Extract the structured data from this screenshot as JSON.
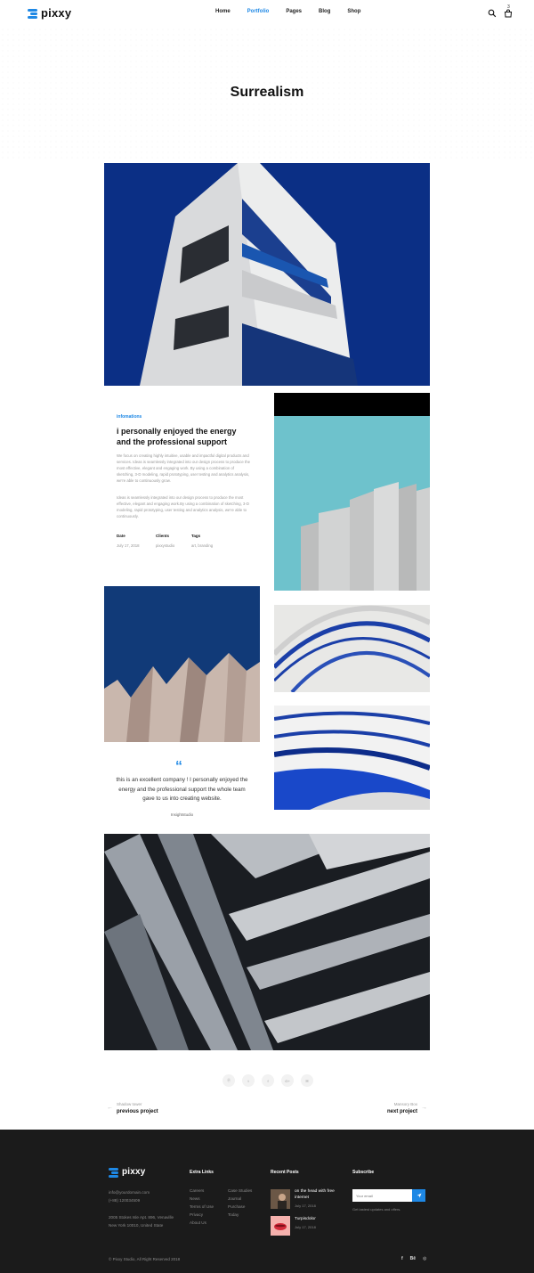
{
  "header": {
    "logo": "pixxy",
    "nav": [
      "Home",
      "Portfolio",
      "Pages",
      "Blog",
      "Shop"
    ],
    "active_nav": "Portfolio",
    "cart_count": "3",
    "icons": [
      "search-icon",
      "cart-icon"
    ]
  },
  "hero": {
    "title": "Surrealism"
  },
  "info": {
    "label": "infomations",
    "heading": "i personally enjoyed the energy and the professional support",
    "para1": "We focus on creating highly intuitive, usable and impactful digital products and services. Ideas is seamlessly integrated into our design process to produce the most effective, elegant and engaging work. By using a combination of sketching, 3-D modeling, rapid prototyping, user testing and analytics analysis, we're able to continuously grow.",
    "para2": "Ideas is seamlessly integrated into our design process to produce the most effective, elegant and engaging work.By using a combination of sketching, 3-D modeling, rapid prototyping, user testing and analytics analysis, we're able to continuously.",
    "meta": [
      {
        "label": "Date",
        "value": "July 17, 2018"
      },
      {
        "label": "Clients",
        "value": "pixxystudio"
      },
      {
        "label": "Tags",
        "value": "art, branding"
      }
    ]
  },
  "quote": {
    "mark": "“",
    "text": "this is an excellent company ! I personally enjoyed the energy and the professional support the whole team gave to us into creating website.",
    "author": "Insightstudio"
  },
  "share": [
    "pinterest-icon",
    "twitter-icon",
    "facebook-icon",
    "google-plus-icon",
    "email-icon"
  ],
  "share_labels": [
    "ⓟ",
    "t",
    "f",
    "G+",
    "✉"
  ],
  "project_nav": {
    "prev_small": "Shadow tower",
    "prev_label": "previous project",
    "next_small": "Mansory Box",
    "next_label": "next project"
  },
  "footer": {
    "logo": "pixxy",
    "email": "info@yourdomain.com",
    "phone": "(+88) 120034509",
    "address1": "2005 Stokes Isle Apt. 896, Venaville",
    "address2": "New York 10010, United State",
    "extra_title": "Extra Links",
    "links_col1": [
      "Careers",
      "News",
      "Terms of Use",
      "Privacy",
      "About Us"
    ],
    "links_col2": [
      "Case Studies",
      "Journal",
      "Purchase",
      "Today"
    ],
    "posts_title": "Recent Posts",
    "posts": [
      {
        "title": "on the head with free internet",
        "date": "July 17, 2018"
      },
      {
        "title": "Turpisdolor",
        "date": "July 17, 2018"
      }
    ],
    "subscribe_title": "Subscribe",
    "subscribe_placeholder": "Your email",
    "subscribe_note": "Get lastest updates and offers.",
    "copyright": "© Pixxy Studio, All Right Reserved 2018",
    "socials": [
      "facebook-icon",
      "behance-icon",
      "dribbble-icon"
    ],
    "social_labels": [
      "f",
      "Bē",
      "◎"
    ]
  },
  "colors": {
    "accent": "#1e88e5",
    "footer_bg": "#1b1b1b"
  }
}
